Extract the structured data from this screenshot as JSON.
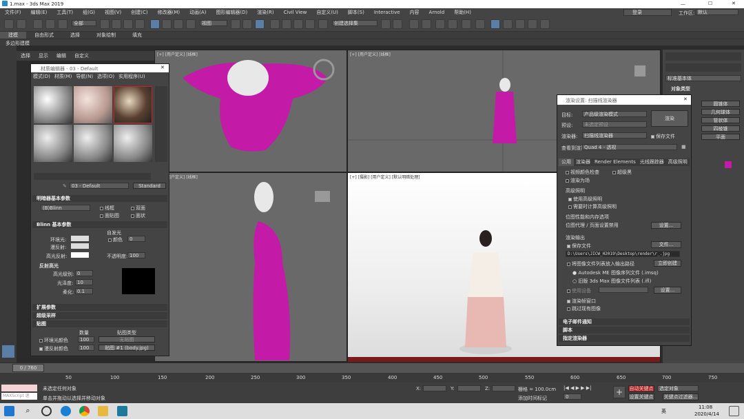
{
  "window": {
    "title": "1.max - 3ds Max 2019",
    "login": "登录",
    "workspace_label": "工作区:",
    "workspace_value": "默认"
  },
  "menu": [
    "文件(F)",
    "编辑(E)",
    "工具(T)",
    "组(G)",
    "视图(V)",
    "创建(C)",
    "修改器(M)",
    "动画(A)",
    "图形编辑器(D)",
    "渲染(R)",
    "Civil View",
    "自定义(U)",
    "脚本(S)",
    "Interactive",
    "内容",
    "Arnold",
    "帮助(H)"
  ],
  "toolbar": {
    "filter": "全部",
    "view": "视图",
    "selset": "创建选择集"
  },
  "ribbon": {
    "tabs": [
      "建模",
      "自由形式",
      "选择",
      "对象绘制",
      "填充"
    ],
    "sub": "多边形建模"
  },
  "scene_menu": [
    "选择",
    "显示",
    "编辑",
    "自定义"
  ],
  "viewports": {
    "top_left": "[+] [用户定义] [线框]",
    "top_right": "[+] [用户定义] [线框]",
    "bottom_left": "[+] [用户定义] [线框]",
    "bottom_right": "[+] [摄影] [用户定义] [默认明暗处理]"
  },
  "material_editor": {
    "title": "材质编辑器 - 03 - Default",
    "menu": [
      "模式(D)",
      "材质(M)",
      "导航(N)",
      "选项(O)",
      "实用程序(U)"
    ],
    "mat_name": "03 - Default",
    "mat_type": "Standard",
    "shader_section": "明暗器基本参数",
    "shader": "(B)Blinn",
    "wire": "线框",
    "two_sided": "双面",
    "face_map": "面贴图",
    "faceted": "面状",
    "blinn_section": "Blinn 基本参数",
    "self_illum": "自发光",
    "color_label": "颜色",
    "color_value": "0",
    "ambient": "环境光:",
    "diffuse": "漫反射:",
    "specular": "高光反射:",
    "opacity_label": "不透明度:",
    "opacity_value": "100",
    "spec_section": "反射高光",
    "spec_level": "高光级别:",
    "spec_level_val": "0",
    "gloss": "光泽度:",
    "gloss_val": "10",
    "soften": "柔化:",
    "soften_val": "0.1",
    "expand_section": "扩展参数",
    "supersample_section": "超级采样",
    "maps_section": "贴图",
    "maps_head": [
      "数量",
      "贴图类型"
    ],
    "maps": [
      {
        "name": "环境光颜色",
        "amount": "100",
        "map": "无贴图"
      },
      {
        "name": "漫反射颜色",
        "amount": "100",
        "map": "贴图 #1 (body.jpg)"
      },
      {
        "name": "高光颜色",
        "amount": "100",
        "map": "无贴图"
      }
    ]
  },
  "render_setup": {
    "title": "渲染设置: 扫描线渲染器",
    "target_label": "目标:",
    "target_value": "产品级渲染模式",
    "preset_label": "预设:",
    "preset_value": "未选定预设",
    "renderer_label": "渲染器:",
    "renderer_value": "扫描线渲染器",
    "render_btn": "渲染",
    "save_file": "保存文件",
    "view_label": "查看到渲染:",
    "view_value": "Quad 4 - 透视",
    "tabs": [
      "公用",
      "渲染器",
      "Render Elements",
      "光线跟踪器",
      "高级照明"
    ],
    "lines": [
      "视频颜色检查",
      "超级黑",
      "渲染为场"
    ],
    "adv_light": "高级照明",
    "use_adv": "使用高级照明",
    "adv_when": "需要时计算高级照明",
    "bitmap": "位图性能和内存选项",
    "bitmap_proxy": "位图代理 / 页面设置禁用",
    "setup_btn": "设置...",
    "output": "渲染输出",
    "save_file2": "保存文件",
    "files_btn": "文件...",
    "path": "D:\\Users\\JICW_H2019\\Desktop\\render\\r_.jpg",
    "put_list": "将图像文件列表放入输出路径",
    "create_now": "立即创建",
    "autodesk": "Autodesk ME 图像序列文件 (.imsq)",
    "legacy": "旧版 3ds Max 图像文件列表 (.ifl)",
    "use_device": "使用设备",
    "device_btn": "设置...",
    "frame_window": "渲染帧窗口",
    "skip": "跳过现有图像",
    "sections": [
      "电子邮件通知",
      "脚本",
      "指定渲染器"
    ]
  },
  "command_panel": {
    "category": "标准基本体",
    "section": "对象类型",
    "items": [
      "圆锥体",
      "几何球体",
      "管状体",
      "四棱锥",
      "平面"
    ]
  },
  "timeline": {
    "frame": "0 / 760",
    "ticks": [
      "0",
      "50",
      "100",
      "150",
      "200",
      "250",
      "300",
      "350",
      "400",
      "450",
      "500",
      "550",
      "600",
      "650",
      "700",
      "750"
    ]
  },
  "status": {
    "maxscript": "MAXScript 迷",
    "line1": "未选定任何对象",
    "line2": "单击并拖动以选择并移动对象",
    "x_label": "X:",
    "y_label": "Y:",
    "z_label": "Z:",
    "grid": "栅格 = 100.0cm",
    "add_tag": "添加时间标记",
    "auto_key": "自动关键点",
    "set_key": "设置关键点",
    "selected": "选定对象",
    "key_filter": "关键点过滤器...",
    "frame": "0"
  },
  "taskbar": {
    "time": "11:08",
    "date": "2020/4/14",
    "lang": "英"
  },
  "colors": {
    "accent": "#5a7fa6",
    "magenta": "#c41aa8",
    "autokey": "#b02020"
  }
}
